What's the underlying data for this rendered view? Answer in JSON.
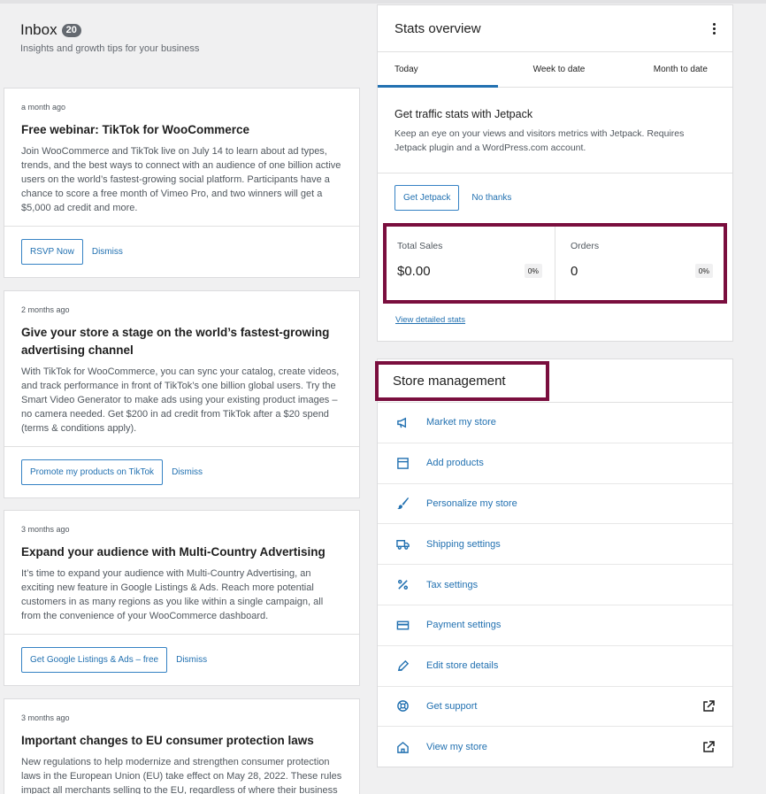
{
  "inbox": {
    "title": "Inbox",
    "count": "20",
    "subtitle": "Insights and growth tips for your business",
    "notes": [
      {
        "date": "a month ago",
        "title": "Free webinar: TikTok for WooCommerce",
        "body": "Join WooCommerce and TikTok live on July 14 to learn about ad types, trends, and the best ways to connect with an audience of one billion active users on the world’s fastest-growing social platform. Participants have a chance to score a free month of Vimeo Pro, and two winners will get a $5,000 ad credit and more.",
        "action": "RSVP Now",
        "dismiss": "Dismiss"
      },
      {
        "date": "2 months ago",
        "title": "Give your store a stage on the world’s fastest-growing advertising channel",
        "body": "With TikTok for WooCommerce, you can sync your catalog, create videos, and track performance in front of TikTok’s one billion global users. Try the Smart Video Generator to make ads using your existing product images – no camera needed. Get $200 in ad credit from TikTok after a $20 spend (terms & conditions apply).",
        "action": "Promote my products on TikTok",
        "dismiss": "Dismiss"
      },
      {
        "date": "3 months ago",
        "title": "Expand your audience with Multi-Country Advertising",
        "body": "It’s time to expand your audience with Multi-Country Advertising, an exciting new feature in Google Listings & Ads. Reach more potential customers in as many regions as you like within a single campaign, all from the convenience of your WooCommerce dashboard.",
        "action": "Get Google Listings & Ads – free",
        "dismiss": "Dismiss"
      },
      {
        "date": "3 months ago",
        "title": "Important changes to EU consumer protection laws",
        "body": "New regulations to help modernize and strengthen consumer protection laws in the European Union (EU) take effect on May 28, 2022. These rules impact all merchants selling to the EU, regardless of where their business"
      }
    ]
  },
  "stats": {
    "title": "Stats overview",
    "tabs": [
      "Today",
      "Week to date",
      "Month to date"
    ],
    "active_tab": "Today",
    "jetpack": {
      "title": "Get traffic stats with Jetpack",
      "text": "Keep an eye on your views and visitors metrics with Jetpack. Requires Jetpack plugin and a WordPress.com account.",
      "primary": "Get Jetpack",
      "secondary": "No thanks"
    },
    "metrics": [
      {
        "label": "Total Sales",
        "value": "$0.00",
        "delta": "0%"
      },
      {
        "label": "Orders",
        "value": "0",
        "delta": "0%"
      }
    ],
    "detail_link": "View detailed stats"
  },
  "store": {
    "title": "Store management",
    "items": [
      {
        "label": "Market my store",
        "icon": "megaphone-icon"
      },
      {
        "label": "Add products",
        "icon": "archive-icon"
      },
      {
        "label": "Personalize my store",
        "icon": "brush-icon"
      },
      {
        "label": "Shipping settings",
        "icon": "truck-icon"
      },
      {
        "label": "Tax settings",
        "icon": "percent-icon"
      },
      {
        "label": "Payment settings",
        "icon": "credit-card-icon"
      },
      {
        "label": "Edit store details",
        "icon": "pencil-icon"
      },
      {
        "label": "Get support",
        "icon": "lifebuoy-icon",
        "external": true
      },
      {
        "label": "View my store",
        "icon": "home-icon",
        "external": true
      }
    ]
  },
  "colors": {
    "accent": "#2271b1",
    "highlight_border": "#7a0e3e"
  }
}
